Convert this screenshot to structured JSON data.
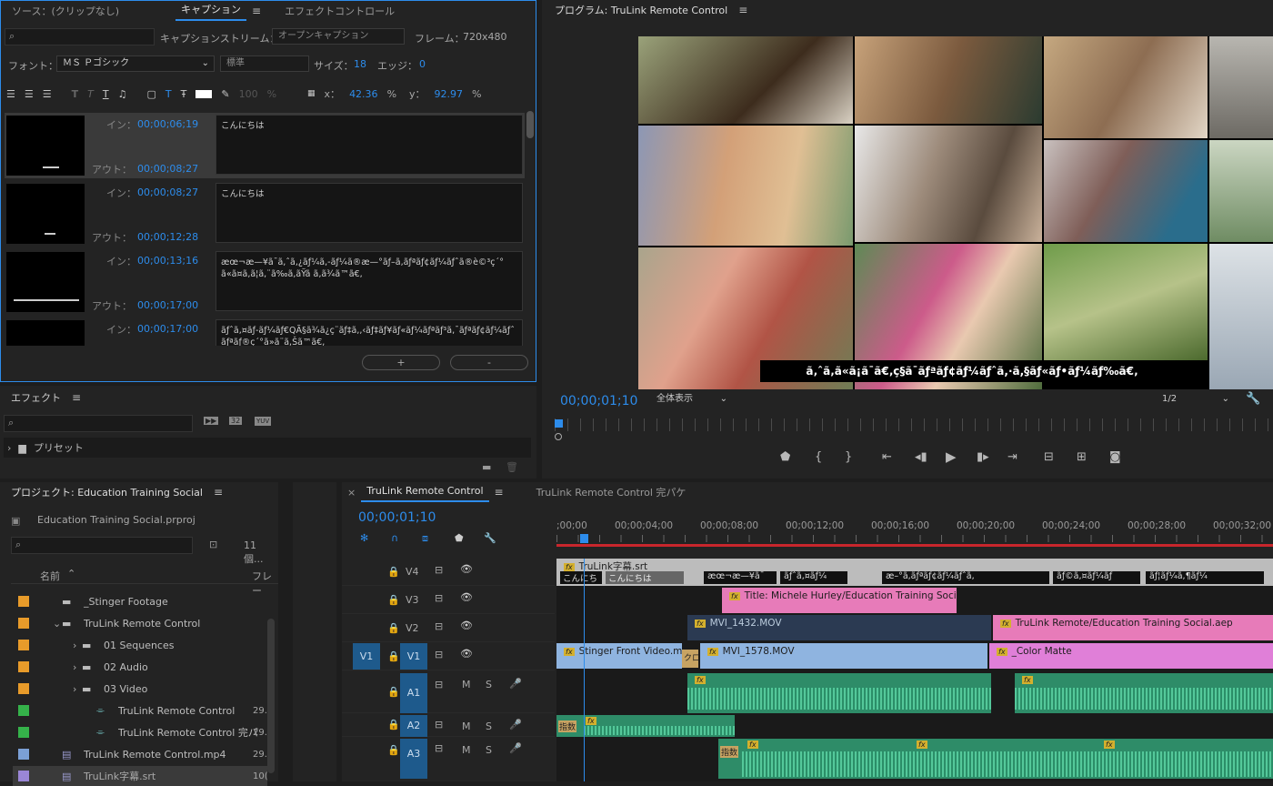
{
  "captions_panel": {
    "tab_source": "ソース：(クリップなし)",
    "tab_captions": "キャプション",
    "tab_effect_controls": "エフェクトコントロール",
    "stream_label": "キャプションストリーム：",
    "stream_value": "オープンキャプション",
    "frame_label": "フレーム：",
    "frame_value": "720x480",
    "font_label": "フォント：",
    "font_value": "ＭＳ Ｐゴシック",
    "style_value": "標準",
    "size_label": "サイズ：",
    "size_value": "18",
    "edge_label": "エッジ：",
    "edge_value": "0",
    "opacity_value": "100",
    "opacity_unit": "%",
    "x_label": "x：",
    "x_value": "42.36",
    "x_unit": "%",
    "y_label": "y：",
    "y_value": "92.97",
    "y_unit": "%",
    "in_label": "イン：",
    "out_label": "アウト：",
    "items": [
      {
        "in": "00;00;06;19",
        "out": "00;00;08;27",
        "text": "こんにちは"
      },
      {
        "in": "00;00;08;27",
        "out": "00;00;12;28",
        "text": "こんにちは"
      },
      {
        "in": "00;00;13;16",
        "out": "00;00;17;00",
        "text": "æœ¬æ—¥ã¯ã,ˆã,¿ãƒ¼ã,-ãƒ¼ã®æ—°ãƒ–ã,ãƒªãƒ¢ãƒ¼ãƒˆã®è©³ç´°ã«ã¤ã,ã¦ã,¨ã‰ã,ãŸã ã‚ã¾ã™ã€,"
      },
      {
        "in": "00;00;17;00",
        "out": "",
        "text": "ãƒˆã,¤ãƒ-ãƒ¼ãƒ€QÃ§ã¾ã¿ç¨ãƒ‡ã‚,‹ãƒ‡ãƒ¥ãƒ«ãƒ¼ãƒªãƒ³ã,¯ãƒªãƒ¢ãƒ¼ãƒˆãƒªãƒ®ç´°ã»ã¨ã,Šã™ã€,"
      }
    ],
    "add_btn": "+",
    "remove_btn": "-"
  },
  "effects_panel": {
    "title": "エフェクト",
    "presets_label": "プリセット",
    "badge_32": "32",
    "badge_yuv": "YUV"
  },
  "program_monitor": {
    "title": "プログラム: TruLink Remote Control",
    "timecode": "00;00;01;10",
    "zoom_value": "全体表示",
    "quality_value": "1/2",
    "caption_overlay": "ã‚ˆã‚ã«ã¡ã¯ã€‚ç§ã¯ãƒªãƒ¢ãƒ¼ãƒˆã,·ã,§ãƒ«ãƒ•ãƒ¼ãƒ‰ã€‚"
  },
  "project_panel": {
    "title": "プロジェクト: Education Training Social",
    "file_name": "Education Training Social.prproj",
    "item_count": "11 個...",
    "col_name": "名前",
    "col_frame": "フレー",
    "items": [
      {
        "label": "_Stinger Footage",
        "color": "#e89b2a",
        "fps": ""
      },
      {
        "label": "TruLink Remote Control",
        "color": "#e89b2a",
        "fps": ""
      },
      {
        "label": "01 Sequences",
        "color": "#e89b2a",
        "fps": ""
      },
      {
        "label": "02 Audio",
        "color": "#e89b2a",
        "fps": ""
      },
      {
        "label": "03 Video",
        "color": "#e89b2a",
        "fps": ""
      },
      {
        "label": "TruLink Remote Control",
        "color": "#35b24a",
        "fps": "29."
      },
      {
        "label": "TruLink Remote Control 完パ",
        "color": "#35b24a",
        "fps": "29."
      },
      {
        "label": "TruLink Remote Control.mp4",
        "color": "#7ba0d6",
        "fps": "29."
      },
      {
        "label": "TruLink字幕.srt",
        "color": "#9a86d6",
        "fps": "10("
      }
    ]
  },
  "timeline": {
    "tab_active": "TruLink Remote Control",
    "tab_inactive": "TruLink Remote Control 完パケ",
    "timecode": "00;00;01;10",
    "ruler": [
      ";00;00",
      "00;00;04;00",
      "00;00;08;00",
      "00;00;12;00",
      "00;00;16;00",
      "00;00;20;00",
      "00;00;24;00",
      "00;00;28;00",
      "00;00;32;00"
    ],
    "tracks": {
      "v4": "V4",
      "v3": "V3",
      "v2": "V2",
      "v1": "V1",
      "v1_src": "V1",
      "a1": "A1",
      "a2": "A2",
      "a3": "A3",
      "m": "M",
      "s": "S"
    },
    "clips": {
      "srt": "TruLink字幕.srt",
      "cap1": "こんにち",
      "cap2": "こんにちは",
      "cap3": "æœ¬æ—¥ã¯",
      "cap4": "ãƒˆã,¤ãƒ¼",
      "cap5": "æ–°ã,ãƒªãƒ¢ãƒ¼ãƒˆã,",
      "cap6": "ãƒ©ã,¤ãƒ¼ãƒ",
      "cap7": "ãƒ¦ãƒ¼ã,¶ãƒ¼",
      "title": "Title: Michele Hurley/Education Training Socia",
      "mvi1432": "MVI_1432.MOV",
      "aep": "TruLink Remote/Education Training Social.aep",
      "stinger": "Stinger Front Video.m",
      "mvi1578": "MVI_1578.MOV",
      "matte": "_Color Matte",
      "trans1": "クロ",
      "trans2": "指数",
      "trans3": "指数"
    }
  },
  "colors": {
    "accent": "#2d8ceb",
    "clip_pink": "#e77bb9",
    "clip_blue": "#8fb4e0",
    "clip_audio": "#2e8c68",
    "playhead": "#2d8ceb"
  }
}
